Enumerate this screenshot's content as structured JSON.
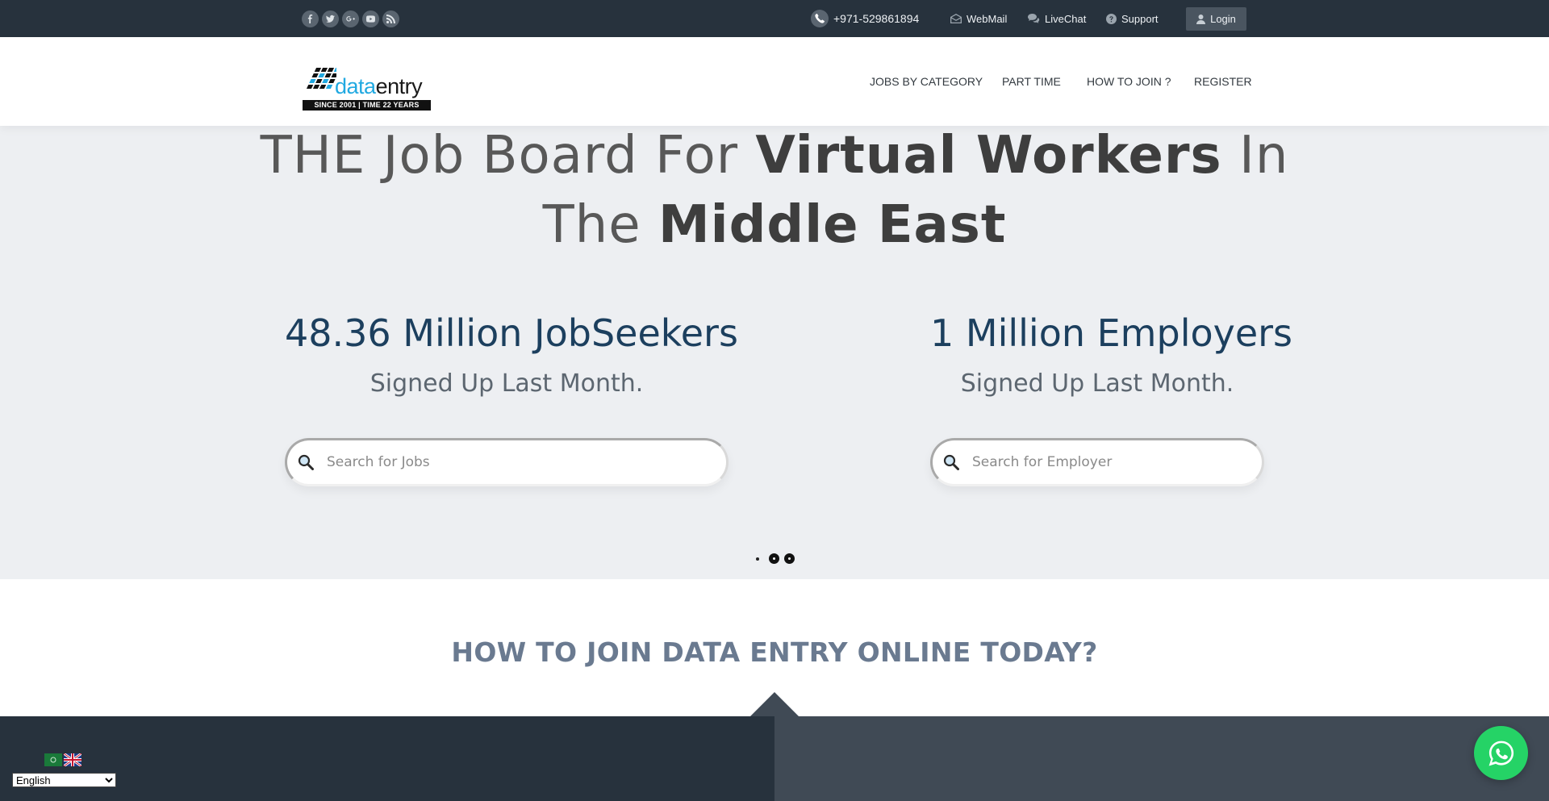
{
  "topbar": {
    "social_icons": [
      "facebook-icon",
      "twitter-icon",
      "google-plus-icon",
      "youtube-icon",
      "rss-icon"
    ],
    "phone": "+971-529861894",
    "webmail": "WebMail",
    "livechat": "LiveChat",
    "support": "Support",
    "login": "Login"
  },
  "header": {
    "logo": {
      "word_part1": "data",
      "word_part2": "entry",
      "since": "SINCE 2001 | TIME 22 YEARS"
    },
    "nav": [
      "JOBS BY CATEGORY",
      "PART TIME",
      "HOW TO JOIN ?",
      "REGISTER"
    ]
  },
  "hero": {
    "line1": {
      "normal_a": "THE Job Board For ",
      "bold": "Virtual Workers",
      "normal_b": " In"
    },
    "line2": {
      "normal": "The ",
      "bold": "Middle East"
    },
    "stats": [
      {
        "big": "48.36 Million JobSeekers",
        "small": "Signed Up Last Month."
      },
      {
        "big": "1 Million Employers",
        "small": "Signed Up Last Month."
      }
    ],
    "search_jobs_placeholder": "Search for Jobs",
    "search_employer_placeholder": "Search for Employer",
    "slider_dots": 3,
    "active_dot": 1
  },
  "how_to_join": {
    "title": "HOW TO JOIN DATA ENTRY ONLINE TODAY?"
  },
  "language": {
    "selected": "English",
    "options": [
      "English"
    ]
  },
  "colors": {
    "topbar_bg": "#27323d",
    "hero_bg": "#edeff2",
    "stat_blue": "#1c3f5e",
    "how_title": "#6a7a90",
    "whatsapp": "#25d366",
    "brand_blue": "#21a9e1"
  }
}
